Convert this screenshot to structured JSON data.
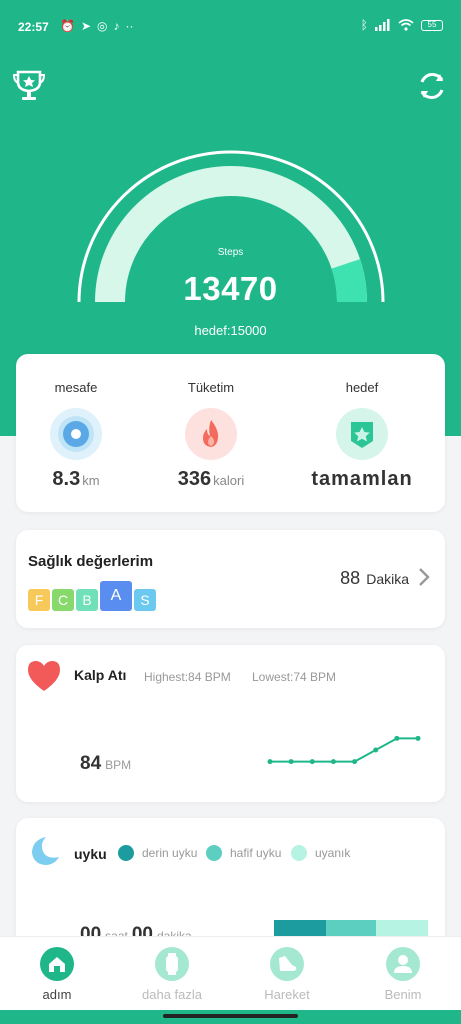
{
  "status": {
    "time": "22:57",
    "battery": "55"
  },
  "gauge": {
    "label": "Steps",
    "value": "13470",
    "goal_text": "hedef:15000",
    "progress": 0.898
  },
  "stats": [
    {
      "title": "mesafe",
      "value": "8.3",
      "unit": "km"
    },
    {
      "title": "Tüketim",
      "value": "336",
      "unit": "kalori"
    },
    {
      "title": "hedef",
      "value": "tamamlan",
      "unit": ""
    }
  ],
  "health": {
    "title": "Sağlık değerlerim",
    "grades": [
      "F",
      "C",
      "B",
      "A",
      "S"
    ],
    "minutes": "88",
    "minutes_unit": "Dakika"
  },
  "heart": {
    "title": "Kalp Atı",
    "highest": "Highest:84  BPM",
    "lowest": "Lowest:74  BPM",
    "value": "84",
    "unit": "BPM",
    "trend": [
      74,
      74,
      74,
      74,
      74,
      79,
      84,
      84
    ]
  },
  "sleep": {
    "title": "uyku",
    "legend": [
      "derin uyku",
      "hafif uyku",
      "uyanık"
    ],
    "hours": "00",
    "hours_unit": "saat",
    "minutes": "00",
    "minutes_unit": "dakika"
  },
  "tabs": [
    {
      "label": "adım",
      "active": true
    },
    {
      "label": "daha fazla",
      "active": false
    },
    {
      "label": "Hareket",
      "active": false
    },
    {
      "label": "Benim",
      "active": false
    }
  ],
  "colors": {
    "brand": "#1fb78a",
    "gauge_track": "#d6f7ea",
    "gauge_fill": "#3ee2b0",
    "deep": "#1c9c9e",
    "light": "#5ccfc1",
    "awake": "#b7f3e3"
  }
}
